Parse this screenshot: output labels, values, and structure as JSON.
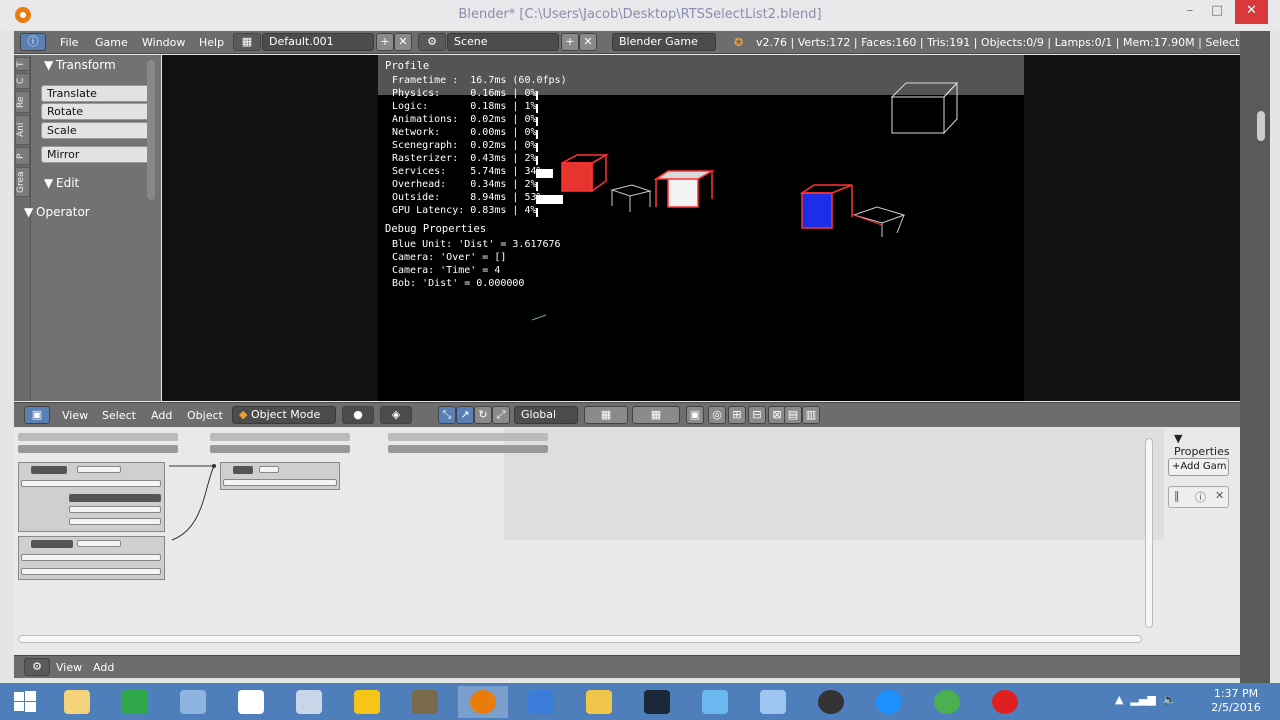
{
  "window": {
    "title": "Blender* [C:\\Users\\Jacob\\Desktop\\RTSSelectList2.blend]",
    "minimize": "–",
    "maximize": "□",
    "close": "✕"
  },
  "info_header": {
    "menus": [
      "File",
      "Game",
      "Window",
      "Help"
    ],
    "screen_layout": "Default.001",
    "scene": "Scene",
    "engine": "Blender Game",
    "stats": "v2.76 | Verts:172 | Faces:160 | Tris:191 | Objects:0/9 | Lamps:0/1 | Mem:17.90M | Selector"
  },
  "tool_shelf": {
    "tabs": [
      "T",
      "C",
      "Re",
      "Ani",
      "P",
      "Grea"
    ],
    "transform_panel": "Transform",
    "buttons": [
      "Translate",
      "Rotate",
      "Scale",
      "Mirror"
    ],
    "edit_panel": "Edit",
    "operator_panel": "Operator"
  },
  "game_overlay": {
    "profile_title": "Profile",
    "profile_lines": [
      "Frametime :  16.7ms (60.0fps)",
      "Physics:     0.16ms | 0%",
      "Logic:       0.18ms | 1%",
      "Animations:  0.02ms | 0%",
      "Network:     0.00ms | 0%",
      "Scenegraph:  0.02ms | 0%",
      "Rasterizer:  0.43ms | 2%",
      "Services:    5.74ms | 34%",
      "Overhead:    0.34ms | 2%",
      "Outside:     8.94ms | 53%",
      "GPU Latency: 0.83ms | 4%"
    ],
    "profile_percent": [
      0,
      1,
      0,
      0,
      0,
      2,
      34,
      2,
      53,
      4
    ],
    "debug_title": "Debug Properties",
    "debug_lines": [
      "Blue Unit: 'Dist' = 3.617676",
      "Camera: 'Over' = []",
      "Camera: 'Time' = 4",
      "Bob: 'Dist' = 0.000000"
    ]
  },
  "viewport_header": {
    "menus": [
      "View",
      "Select",
      "Add",
      "Object"
    ],
    "mode": "Object Mode",
    "orientation": "Global"
  },
  "logic_editor": {
    "properties_title": "Properties",
    "add_game_property": "Add Gam"
  },
  "logic_header": {
    "menus": [
      "View",
      "Add"
    ]
  },
  "taskbar": {
    "time": "1:37 PM",
    "date": "2/5/2016",
    "apps": [
      "file-explorer-icon",
      "spreadsheet-icon",
      "paint-icon",
      "internet-explorer-icon",
      "photo-viewer-icon",
      "google-drive-icon",
      "gimp-icon",
      "blender-icon",
      "outlook-icon",
      "folder-icon",
      "steam-icon",
      "network-icon",
      "settings-icon",
      "obs-icon",
      "clock-icon",
      "chrome-icon",
      "record-icon"
    ]
  },
  "colors": {
    "blender_panel": "#727272",
    "viewport_bg": "#111111",
    "taskbar": "#4e7fbb",
    "close_red": "#d9393a",
    "cube_red": "#e8342f",
    "cube_blue": "#1d2ee8"
  }
}
